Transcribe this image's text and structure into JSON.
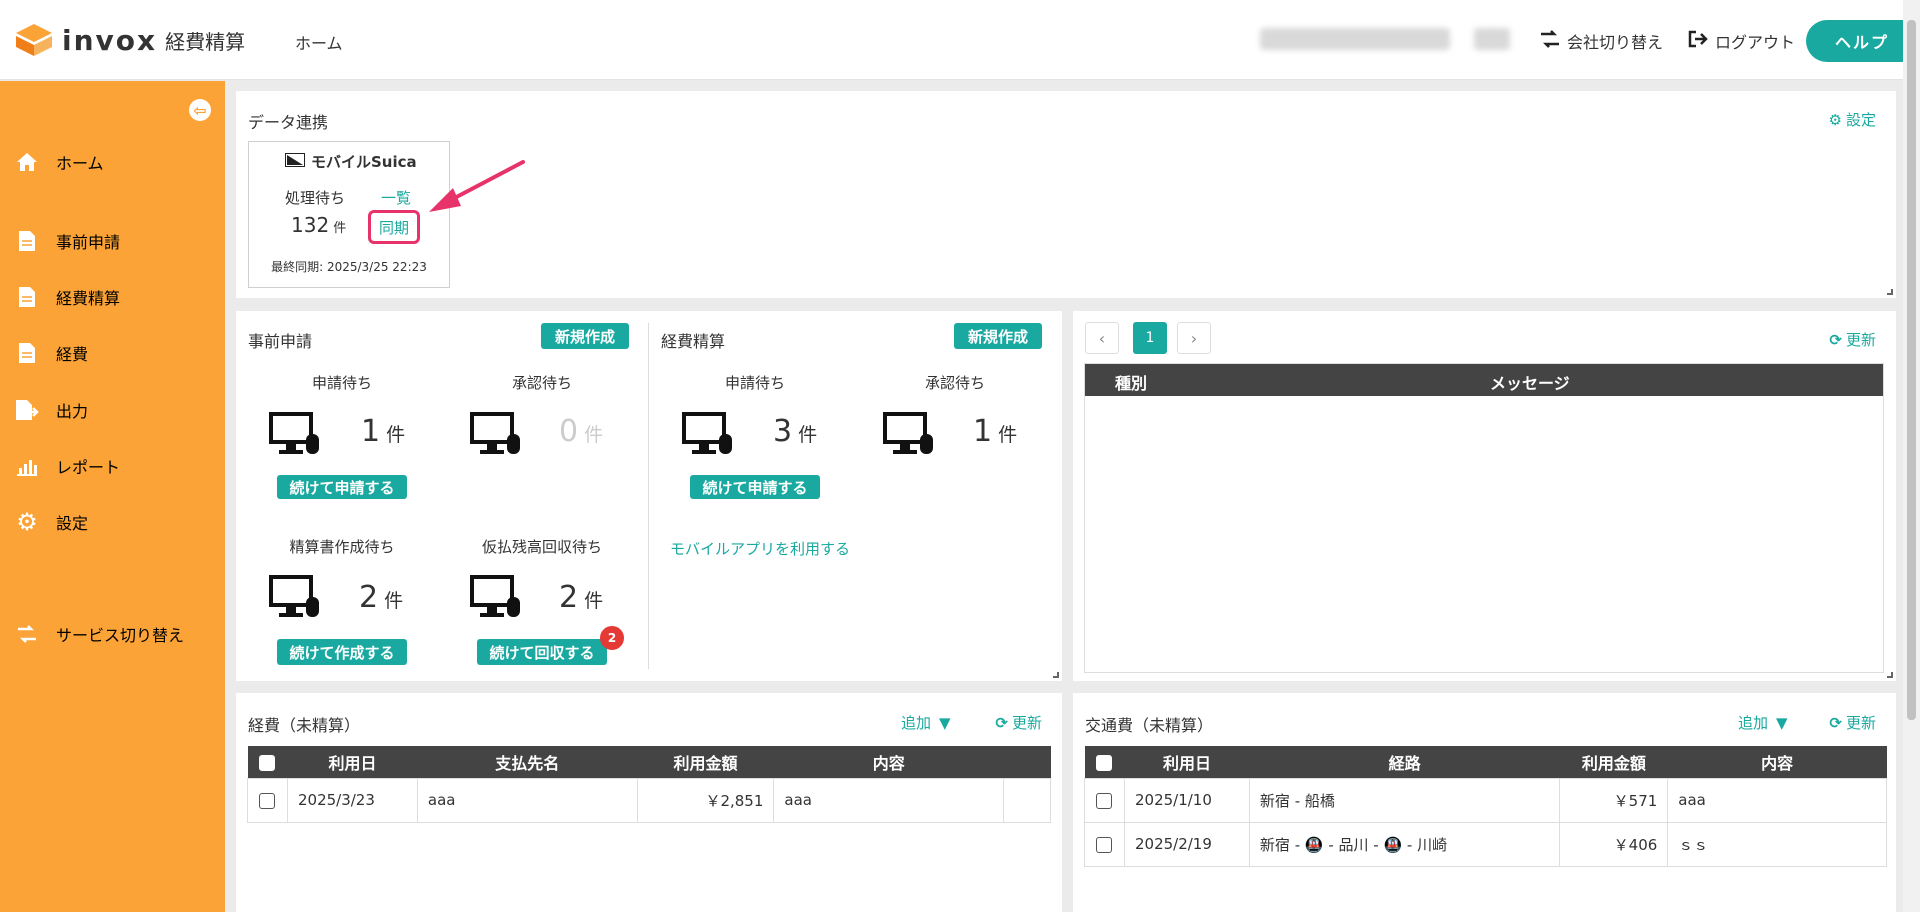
{
  "header": {
    "logo_text": "invox",
    "logo_sub": "経費精算",
    "home": "ホーム",
    "switch_company": "会社切り替え",
    "logout": "ログアウト",
    "help": "ヘルプ"
  },
  "sidebar": {
    "items": [
      {
        "label": "ホーム",
        "icon": "home-icon"
      },
      {
        "label": "事前申請",
        "icon": "document-icon"
      },
      {
        "label": "経費精算",
        "icon": "document-icon"
      },
      {
        "label": "経費",
        "icon": "document-icon"
      },
      {
        "label": "出力",
        "icon": "export-icon"
      },
      {
        "label": "レポート",
        "icon": "chart-icon"
      },
      {
        "label": "設定",
        "icon": "gear-icon"
      },
      {
        "label": "サービス切り替え",
        "icon": "switch-icon"
      }
    ]
  },
  "data_link": {
    "title": "データ連携",
    "settings": "設定",
    "card": {
      "name": "モバイルSuica",
      "pending_label": "処理待ち",
      "pending_count": "132",
      "unit": "件",
      "list_link": "一覧",
      "sync_link": "同期",
      "last_sync": "最終同期: 2025/3/25 22:23"
    }
  },
  "pre_application": {
    "title": "事前申請",
    "new_button": "新規作成",
    "stats": [
      {
        "label": "申請待ち",
        "count": "1",
        "unit": "件"
      },
      {
        "label": "承認待ち",
        "count": "0",
        "unit": "件"
      },
      {
        "label": "精算書作成待ち",
        "count": "2",
        "unit": "件"
      },
      {
        "label": "仮払残高回収待ち",
        "count": "2",
        "unit": "件"
      }
    ],
    "continue_apply": "続けて申請する",
    "continue_create": "続けて作成する",
    "continue_collect": "続けて回収する",
    "collect_badge": "2"
  },
  "expense_settlement": {
    "title": "経費精算",
    "new_button": "新規作成",
    "stats": [
      {
        "label": "申請待ち",
        "count": "3",
        "unit": "件"
      },
      {
        "label": "承認待ち",
        "count": "1",
        "unit": "件"
      }
    ],
    "continue_apply": "続けて申請する",
    "mobile_app_link": "モバイルアプリを利用する"
  },
  "messages": {
    "page": "1",
    "refresh": "更新",
    "columns": [
      "種別",
      "メッセージ"
    ]
  },
  "expenses_unsettled": {
    "title": "経費（未精算）",
    "add": "追加",
    "refresh": "更新",
    "columns": [
      "利用日",
      "支払先名",
      "利用金額",
      "内容"
    ],
    "rows": [
      {
        "date": "2025/3/23",
        "payee": "aaa",
        "amount": "￥2,851",
        "content": "aaa"
      }
    ]
  },
  "transport_unsettled": {
    "title": "交通費（未精算）",
    "add": "追加",
    "refresh": "更新",
    "columns": [
      "利用日",
      "経路",
      "利用金額",
      "内容"
    ],
    "rows": [
      {
        "date": "2025/1/10",
        "route": "新宿 - 船橋",
        "amount": "￥571",
        "content": "aaa"
      },
      {
        "date": "2025/2/19",
        "route": "新宿 - 🚇 - 品川 - 🚇 - 川崎",
        "amount": "￥406",
        "content": "ｓｓ"
      }
    ]
  },
  "colors": {
    "accent": "#1aa9a0",
    "sidebar": "#fba336",
    "annotation": "#e8336a"
  }
}
